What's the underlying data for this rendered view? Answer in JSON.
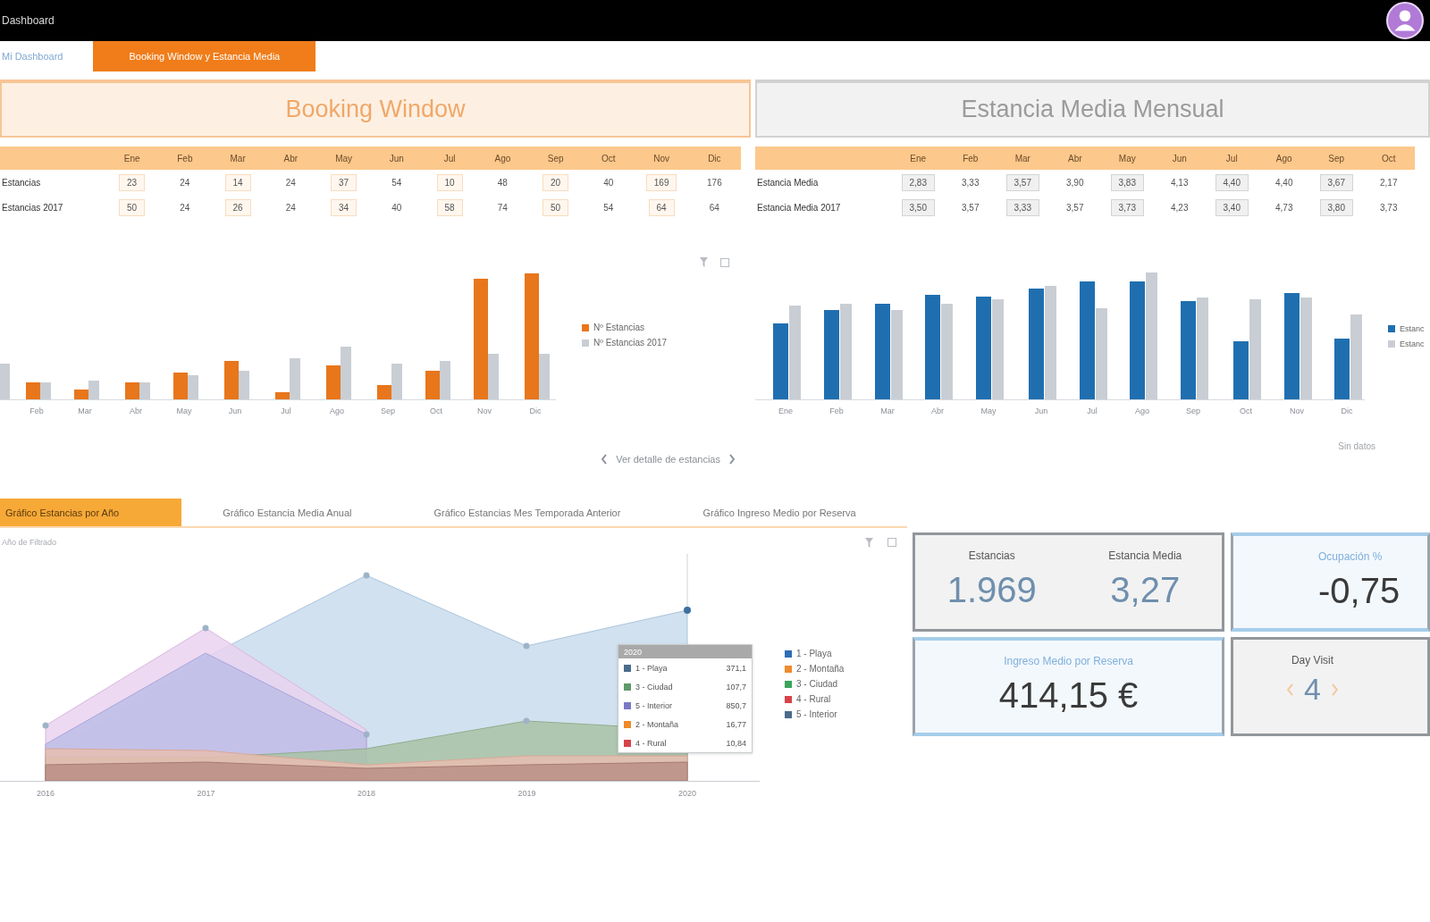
{
  "top_bar": {
    "title": "Dashboard"
  },
  "nav_tabs": [
    {
      "label": "Mi Dashboard",
      "selected": false
    },
    {
      "label": "Booking Window y Estancia Media",
      "selected": true
    }
  ],
  "sections": [
    {
      "title": "Booking Window",
      "selected": true,
      "table": {
        "columns": [
          "Ene",
          "Feb",
          "Mar",
          "Abr",
          "May",
          "Jun",
          "Jul",
          "Ago",
          "Sep",
          "Oct",
          "Nov",
          "Dic"
        ],
        "rows": [
          {
            "label": "Estancias",
            "cells": [
              "23",
              "24",
              "14",
              "24",
              "37",
              "54",
              "10",
              "48",
              "20",
              "40",
              "169",
              "176"
            ]
          },
          {
            "label": "Estancias 2017",
            "cells": [
              "50",
              "24",
              "26",
              "24",
              "34",
              "40",
              "58",
              "74",
              "50",
              "54",
              "64",
              "64"
            ]
          }
        ]
      },
      "chart": {
        "x_labels": [
          "Feb",
          "Mar",
          "Abr",
          "May",
          "Jun",
          "Jul",
          "Ago",
          "Sep",
          "Oct",
          "Nov",
          "Dic"
        ],
        "legend": [
          {
            "label": "Nº Estancias",
            "color": "#e8761b"
          },
          {
            "label": "Nº Estancias 2017",
            "color": "#c9ced4"
          }
        ]
      },
      "footer": {
        "kind": "pager",
        "text": "Ver detalle de estancias"
      }
    },
    {
      "title": "Estancia Media Mensual",
      "selected": false,
      "table": {
        "columns": [
          "Ene",
          "Feb",
          "Mar",
          "Abr",
          "May",
          "Jun",
          "Jul",
          "Ago",
          "Sep",
          "Oct"
        ],
        "rows": [
          {
            "label": "Estancia Media",
            "cells": [
              "2,83",
              "3,33",
              "3,57",
              "3,90",
              "3,83",
              "4,13",
              "4,40",
              "4,40",
              "3,67",
              "2,17"
            ]
          },
          {
            "label": "Estancia Media 2017",
            "cells": [
              "3,50",
              "3,57",
              "3,33",
              "3,57",
              "3,73",
              "4,23",
              "3,40",
              "4,73",
              "3,80",
              "3,73"
            ]
          }
        ]
      },
      "chart": {
        "x_labels": [
          "Ene",
          "Feb",
          "Mar",
          "Abr",
          "May",
          "Jun",
          "Jul",
          "Ago",
          "Sep",
          "Oct",
          "Nov",
          "Dic"
        ],
        "legend": [
          {
            "label": "Estanc",
            "color": "#1f6fb0"
          },
          {
            "label": "Estanc",
            "color": "#c9ced4"
          }
        ]
      },
      "footer": {
        "kind": "note",
        "text": "Sin datos"
      }
    }
  ],
  "report_tabs": [
    {
      "label": "Gráfico Estancias por Año",
      "selected": true
    },
    {
      "label": "Gráfico Estancia Media Anual",
      "selected": false
    },
    {
      "label": "Gráfico Estancias Mes Temporada Anterior",
      "selected": false
    },
    {
      "label": "Gráfico Ingreso Medio por Reserva",
      "selected": false
    }
  ],
  "area_chart": {
    "filter_label": "Año de Filtrado",
    "x_labels": [
      "2016",
      "2017",
      "2018",
      "2019",
      "2020"
    ],
    "tooltip": {
      "title": "2020",
      "rows": [
        {
          "label": "1 - Playa",
          "value": "371,1",
          "color": "#4a6c8c"
        },
        {
          "label": "3 - Ciudad",
          "value": "107,7",
          "color": "#5f9a6a"
        },
        {
          "label": "5 - Interior",
          "value": "850,7",
          "color": "#7c79c4"
        },
        {
          "label": "2 - Montaña",
          "value": "16,77",
          "color": "#f08a2c"
        },
        {
          "label": "4 - Rural",
          "value": "10,84",
          "color": "#d8434a"
        }
      ]
    },
    "legend": [
      {
        "label": "1 - Playa",
        "color": "#2f6db5"
      },
      {
        "label": "2 - Montaña",
        "color": "#f08a2c"
      },
      {
        "label": "3 - Ciudad",
        "color": "#3aa55a"
      },
      {
        "label": "4 - Rural",
        "color": "#d8434a"
      },
      {
        "label": "5 - Interior",
        "color": "#4a6c8c"
      }
    ]
  },
  "kpis": [
    {
      "kind": "pair",
      "highlighted": false,
      "items": [
        {
          "label": "Estancias",
          "value": "1.969"
        },
        {
          "label": "Estancia Media",
          "value": "3,27"
        }
      ]
    },
    {
      "kind": "single",
      "highlighted": true,
      "label": "Ocupación %",
      "value": "-0,75"
    },
    {
      "kind": "single",
      "highlighted": true,
      "label": "Ingreso Medio por Reserva",
      "value": "414,15 €"
    },
    {
      "kind": "stepper",
      "highlighted": false,
      "label": "Day Visit",
      "value": "4"
    }
  ]
}
